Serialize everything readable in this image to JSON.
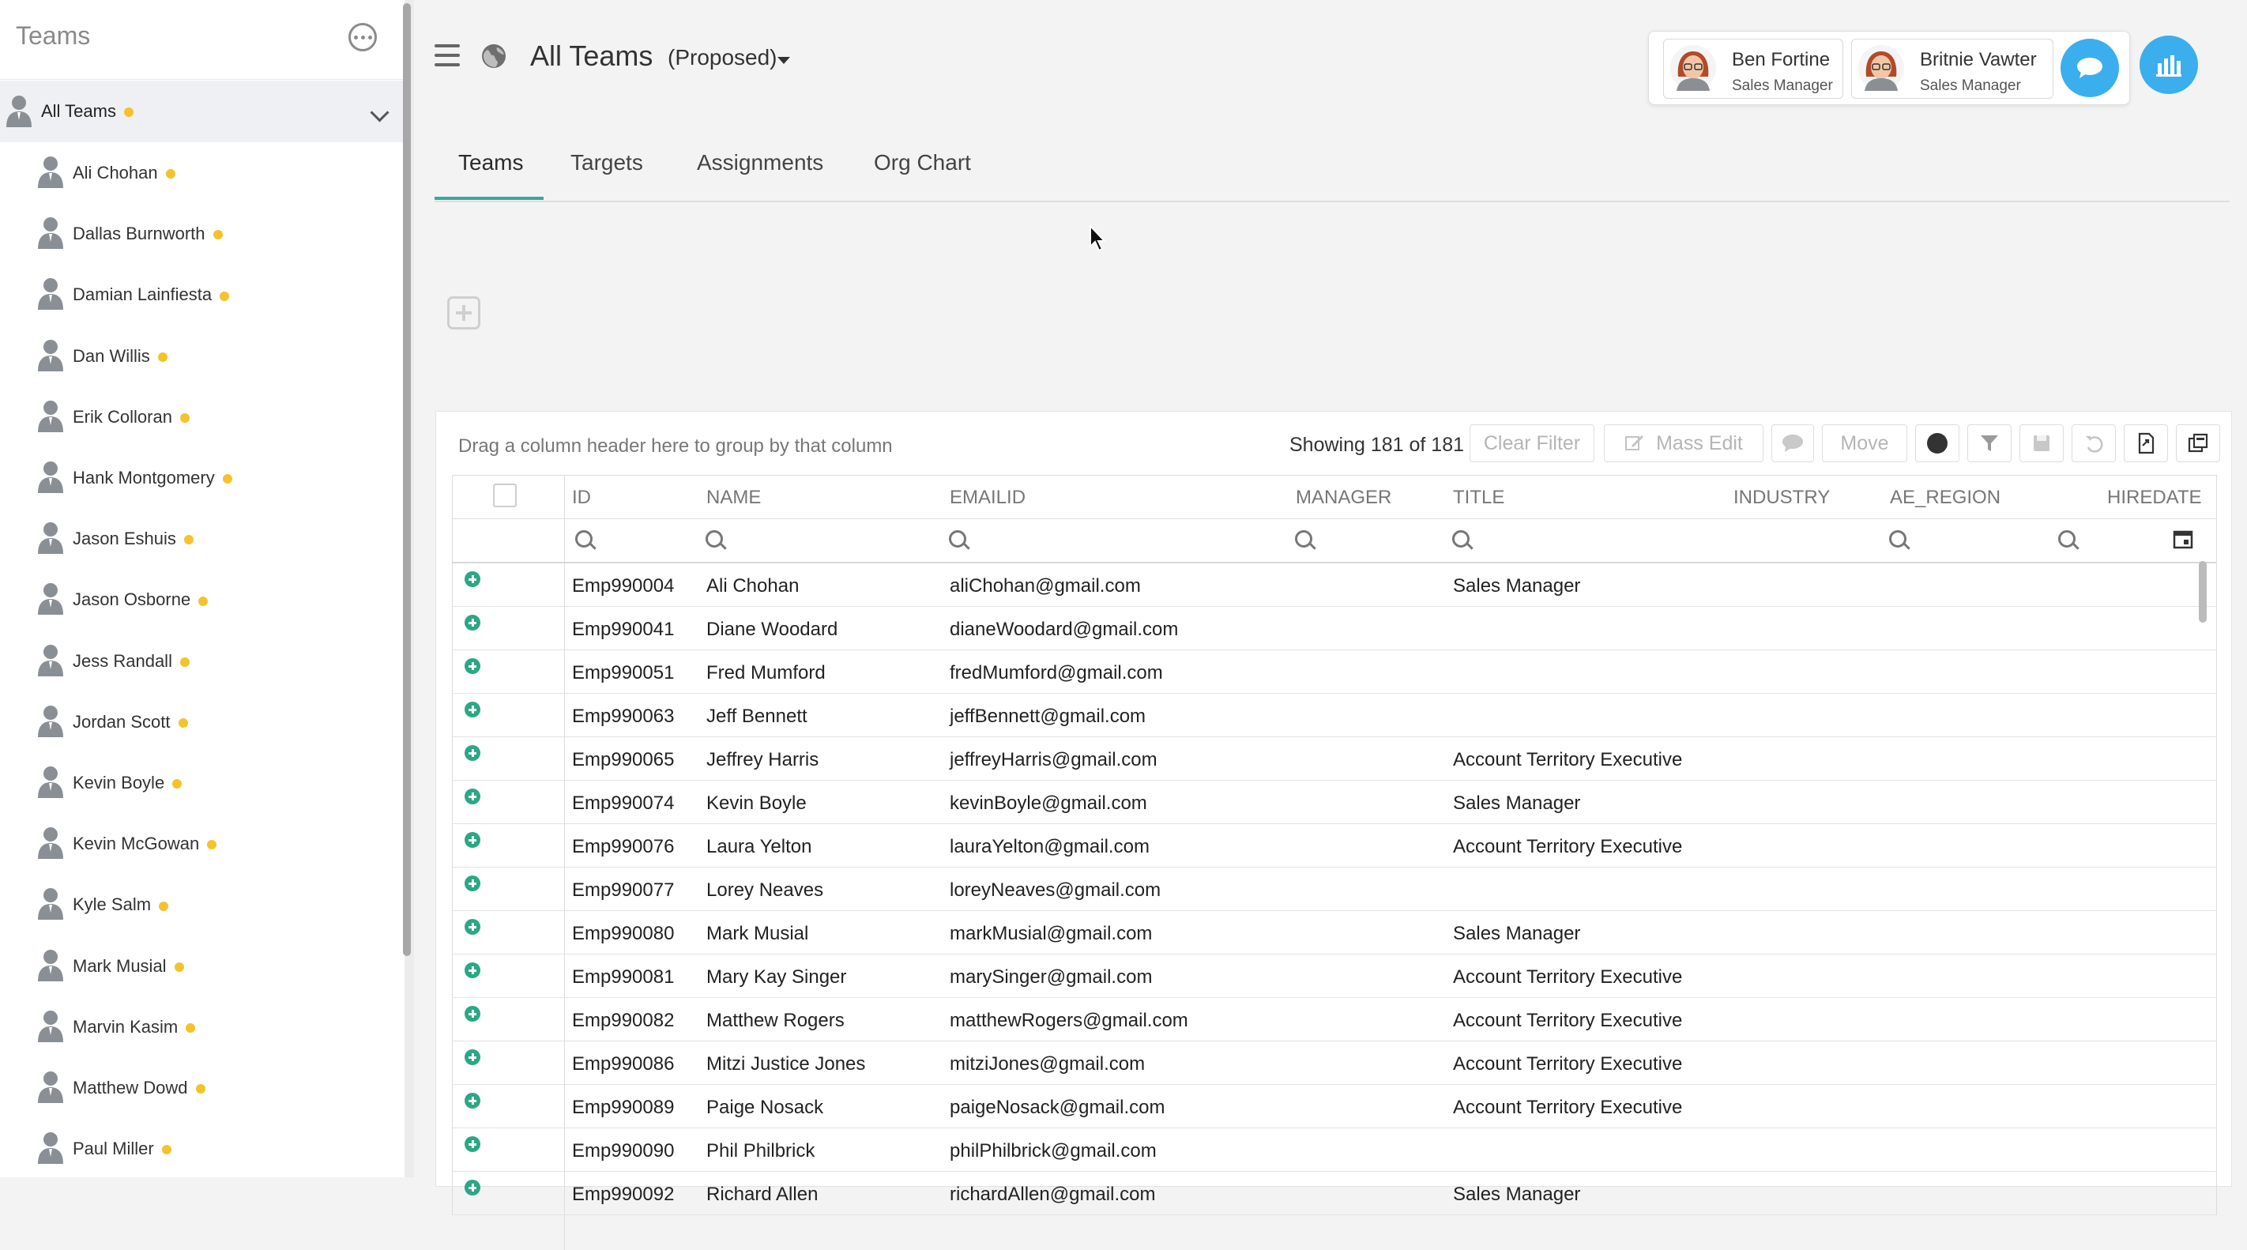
{
  "sidebar": {
    "title": "Teams",
    "all_teams_label": "All Teams",
    "items": [
      {
        "label": "Ali Chohan"
      },
      {
        "label": "Dallas Burnworth"
      },
      {
        "label": "Damian Lainfiesta"
      },
      {
        "label": "Dan Willis"
      },
      {
        "label": "Erik Colloran"
      },
      {
        "label": "Hank Montgomery"
      },
      {
        "label": "Jason Eshuis"
      },
      {
        "label": "Jason Osborne"
      },
      {
        "label": "Jess Randall"
      },
      {
        "label": "Jordan Scott"
      },
      {
        "label": "Kevin Boyle"
      },
      {
        "label": "Kevin McGowan"
      },
      {
        "label": "Kyle Salm"
      },
      {
        "label": "Mark Musial"
      },
      {
        "label": "Marvin Kasim"
      },
      {
        "label": "Matthew Dowd"
      },
      {
        "label": "Paul Miller"
      }
    ],
    "status_color": "#f5c22b"
  },
  "header": {
    "title": "All Teams",
    "scenario": "(Proposed)",
    "users": [
      {
        "name": "Ben Fortine",
        "role": "Sales Manager"
      },
      {
        "name": "Britnie Vawter",
        "role": "Sales Manager"
      }
    ],
    "accent_color": "#3baeee"
  },
  "tabs": [
    {
      "label": "Teams",
      "active": true
    },
    {
      "label": "Targets"
    },
    {
      "label": "Assignments"
    },
    {
      "label": "Org Chart"
    }
  ],
  "grid": {
    "group_hint": "Drag a column header here to group by that column",
    "showing": "Showing 181 of 181",
    "toolbar": {
      "clear_filter": "Clear Filter",
      "mass_edit": "Mass Edit",
      "move": "Move"
    },
    "columns": [
      "ID",
      "NAME",
      "EMAILID",
      "MANAGER",
      "TITLE",
      "INDUSTRY",
      "AE_REGION",
      "HIREDATE"
    ],
    "rows": [
      {
        "id": "Emp990004",
        "name": "Ali Chohan",
        "email": "aliChohan@gmail.com",
        "title": "Sales Manager"
      },
      {
        "id": "Emp990041",
        "name": "Diane Woodard",
        "email": "dianeWoodard@gmail.com",
        "title": ""
      },
      {
        "id": "Emp990051",
        "name": "Fred Mumford",
        "email": "fredMumford@gmail.com",
        "title": ""
      },
      {
        "id": "Emp990063",
        "name": "Jeff Bennett",
        "email": "jeffBennett@gmail.com",
        "title": ""
      },
      {
        "id": "Emp990065",
        "name": "Jeffrey Harris",
        "email": "jeffreyHarris@gmail.com",
        "title": "Account Territory Executive"
      },
      {
        "id": "Emp990074",
        "name": "Kevin Boyle",
        "email": "kevinBoyle@gmail.com",
        "title": "Sales Manager"
      },
      {
        "id": "Emp990076",
        "name": "Laura Yelton",
        "email": "lauraYelton@gmail.com",
        "title": "Account Territory Executive"
      },
      {
        "id": "Emp990077",
        "name": "Lorey Neaves",
        "email": "loreyNeaves@gmail.com",
        "title": ""
      },
      {
        "id": "Emp990080",
        "name": "Mark Musial",
        "email": "markMusial@gmail.com",
        "title": "Sales Manager"
      },
      {
        "id": "Emp990081",
        "name": "Mary Kay Singer",
        "email": "marySinger@gmail.com",
        "title": "Account Territory Executive"
      },
      {
        "id": "Emp990082",
        "name": "Matthew Rogers",
        "email": "matthewRogers@gmail.com",
        "title": "Account Territory Executive"
      },
      {
        "id": "Emp990086",
        "name": "Mitzi Justice Jones",
        "email": "mitziJones@gmail.com",
        "title": "Account Territory Executive"
      },
      {
        "id": "Emp990089",
        "name": "Paige Nosack",
        "email": "paigeNosack@gmail.com",
        "title": "Account Territory Executive"
      },
      {
        "id": "Emp990090",
        "name": "Phil Philbrick",
        "email": "philPhilbrick@gmail.com",
        "title": ""
      },
      {
        "id": "Emp990092",
        "name": "Richard Allen",
        "email": "richardAllen@gmail.com",
        "title": "Sales Manager"
      }
    ]
  }
}
